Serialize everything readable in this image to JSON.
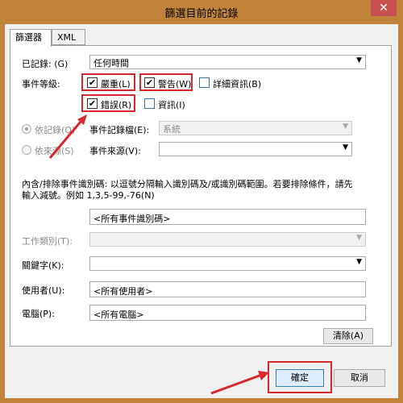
{
  "window": {
    "title": "篩選目前的記錄",
    "close_glyph": "✕"
  },
  "tabs": [
    {
      "label": "篩選器"
    },
    {
      "label": "XML"
    }
  ],
  "logged": {
    "label": "已記錄: (G)",
    "value": "任何時間"
  },
  "event_level": {
    "label": "事件等級:",
    "critical": "嚴重(L)",
    "warning": "警告(W)",
    "verbose": "詳細資訊(B)",
    "error": "錯誤(R)",
    "information": "資訊(I)"
  },
  "by_log": {
    "label": "依記錄(O)",
    "field_label": "事件記錄檔(E):",
    "value": "系統"
  },
  "by_source": {
    "label": "依來源(S)",
    "field_label": "事件來源(V):",
    "value": ""
  },
  "event_ids": {
    "description_line1": "內含/排除事件識別碼: 以逗號分隔輸入識別碼及/或識別碼範圍。若要排除條件，請先",
    "description_line2": "輸入減號。例如 1,3,5-99,-76(N)",
    "value": "<所有事件識別碼>"
  },
  "task_category": {
    "label": "工作類別(T):",
    "value": ""
  },
  "keywords": {
    "label": "關鍵字(K):",
    "value": ""
  },
  "user": {
    "label": "使用者(U):",
    "value": "<所有使用者>"
  },
  "computer": {
    "label": "電腦(P):",
    "value": "<所有電腦>"
  },
  "buttons": {
    "clear": "清除(A)",
    "ok": "確定",
    "cancel": "取消"
  },
  "icons": {
    "check": "✔",
    "dropdown": "▼"
  },
  "colors": {
    "title_bar": "#c1833a",
    "highlight": "#d9272e",
    "close_button": "#c75050"
  }
}
